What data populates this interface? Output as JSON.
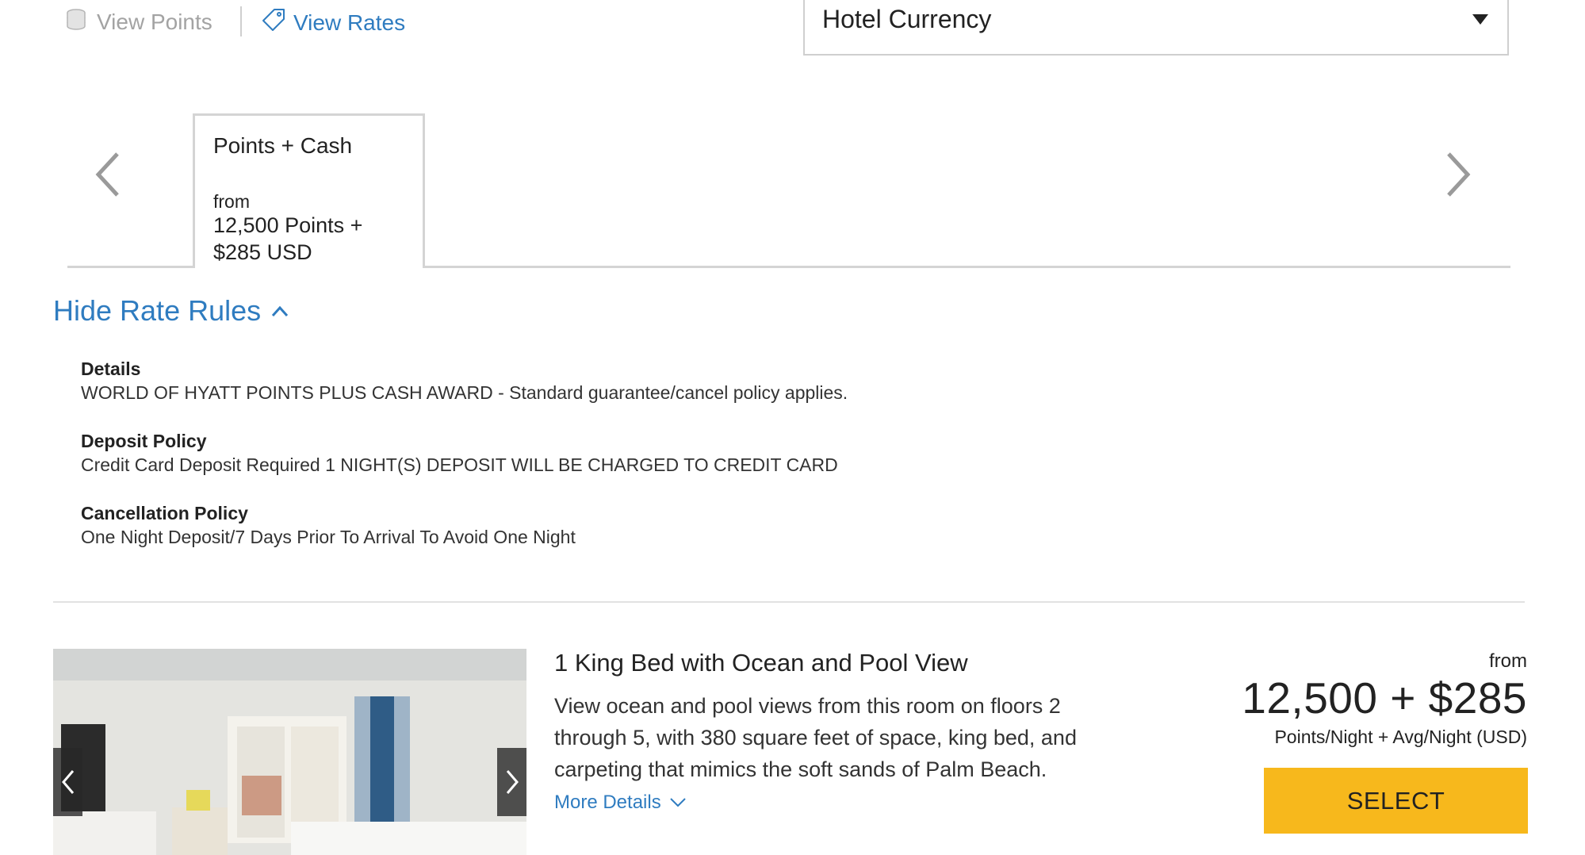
{
  "rate_toggle": {
    "view_points_label": "View Points",
    "view_rates_label": "View Rates"
  },
  "currency": {
    "selected": "Hotel Currency"
  },
  "rate_tabs": [
    {
      "title": "Points + Cash",
      "from_label": "from",
      "amount": "12,500 Points + $285 USD"
    }
  ],
  "rate_rules": {
    "toggle_label": "Hide Rate Rules",
    "items": [
      {
        "title": "Details",
        "text": "WORLD OF HYATT POINTS PLUS CASH AWARD - Standard guarantee/cancel policy applies."
      },
      {
        "title": "Deposit Policy",
        "text": "Credit Card Deposit Required 1 NIGHT(S) DEPOSIT WILL BE CHARGED TO CREDIT CARD"
      },
      {
        "title": "Cancellation Policy",
        "text": "One Night Deposit/7 Days Prior To Arrival To Avoid One Night"
      }
    ]
  },
  "room": {
    "title": "1 King Bed with Ocean and Pool View",
    "description": "View ocean and pool views from this room on floors 2 through 5, with 380 square feet of space, king bed, and carpeting that mimics the soft sands of Palm Beach.",
    "more_details_label": "More Details",
    "price_from_label": "from",
    "price": "12,500 + $285",
    "price_caption": "Points/Night + Avg/Night (USD)",
    "select_label": "SELECT"
  },
  "colors": {
    "link": "#2f7cc0",
    "select_button": "#f7b81c",
    "border": "#d4d4d4"
  },
  "icons": {
    "view_points": "coins-icon",
    "view_rates": "tag-icon",
    "currency": "caret-down-icon",
    "rules_toggle": "chevron-up-icon",
    "more_details": "chevron-down-icon",
    "carousel_prev": "chevron-left-icon",
    "carousel_next": "chevron-right-icon"
  }
}
